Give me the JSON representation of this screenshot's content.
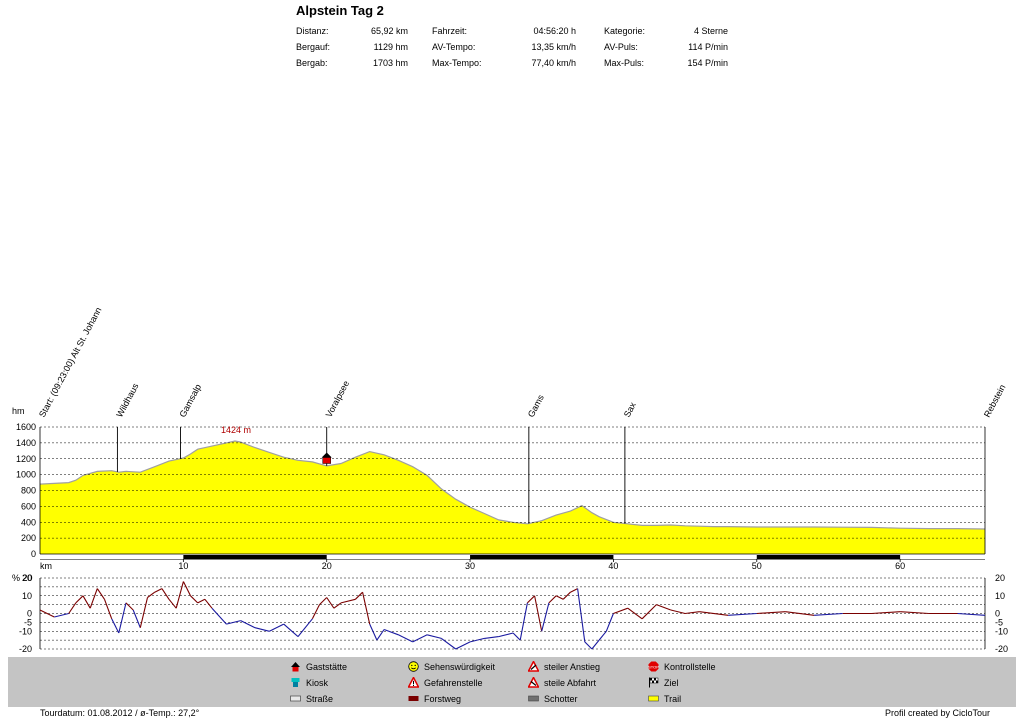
{
  "title": "Alpstein Tag 2",
  "stats": [
    [
      {
        "label": "Distanz:",
        "value": "65,92 km"
      },
      {
        "label": "Fahrzeit:",
        "value": "04:56:20 h"
      },
      {
        "label": "Kategorie:",
        "value": "4 Sterne"
      }
    ],
    [
      {
        "label": "Bergauf:",
        "value": "1129 hm"
      },
      {
        "label": "AV-Tempo:",
        "value": "13,35 km/h"
      },
      {
        "label": "AV-Puls:",
        "value": "114 P/min"
      }
    ],
    [
      {
        "label": "Bergab:",
        "value": "1703 hm"
      },
      {
        "label": "Max-Tempo:",
        "value": "77,40 km/h"
      },
      {
        "label": "Max-Puls:",
        "value": "154 P/min"
      }
    ]
  ],
  "colors": {
    "profile_fill": "#ffff00",
    "profile_line": "#a0a0a0",
    "grade_pos": "#7a0000",
    "grade_neg": "#1a1aa0",
    "km_band": "#000000",
    "legend_bg": "#c4c4c4"
  },
  "chart_data": [
    {
      "type": "area",
      "ylabel": "hm",
      "xlabel": "km",
      "xlim": [
        0,
        65.92
      ],
      "ylim": [
        0,
        1600
      ],
      "yticks": [
        0,
        200,
        400,
        600,
        800,
        1000,
        1200,
        1400,
        1600
      ],
      "xticks": [
        10,
        20,
        30,
        40,
        50,
        60
      ],
      "grid": true,
      "max_label": "1424 m",
      "max_point": {
        "x": 13.6,
        "y": 1424
      },
      "x": [
        0,
        1,
        2,
        2.5,
        3,
        4,
        5,
        5.5,
        6,
        7,
        8,
        9,
        10,
        10.5,
        11,
        12,
        13,
        13.6,
        14,
        15,
        16,
        17,
        18,
        19,
        20,
        21,
        22,
        23,
        24,
        25,
        26,
        27,
        28,
        29,
        30,
        31,
        32,
        33,
        34,
        35,
        36,
        37,
        37.8,
        38.5,
        39,
        40,
        41,
        42,
        43,
        44,
        45,
        46,
        47,
        48,
        50,
        52,
        54,
        56,
        58,
        60,
        62,
        64,
        65.92
      ],
      "y": [
        880,
        890,
        900,
        930,
        990,
        1040,
        1050,
        1030,
        1040,
        1030,
        1100,
        1170,
        1210,
        1260,
        1320,
        1360,
        1400,
        1424,
        1410,
        1340,
        1280,
        1220,
        1180,
        1160,
        1110,
        1140,
        1220,
        1290,
        1250,
        1180,
        1100,
        990,
        820,
        690,
        590,
        510,
        430,
        400,
        380,
        420,
        490,
        540,
        610,
        520,
        470,
        400,
        380,
        360,
        360,
        365,
        355,
        350,
        345,
        345,
        340,
        340,
        340,
        338,
        335,
        325,
        320,
        320,
        315
      ],
      "annotations": [
        {
          "x": 0,
          "label": "Start: (09:23:00) Alt St. Johann"
        },
        {
          "x": 5.4,
          "label": "Wildhaus"
        },
        {
          "x": 9.8,
          "label": "Gamsalp"
        },
        {
          "x": 20,
          "label": "Voralpsee"
        },
        {
          "x": 34.1,
          "label": "Gams"
        },
        {
          "x": 40.8,
          "label": "Sax"
        },
        {
          "x": 65.92,
          "label": "Rebstein"
        }
      ],
      "km_band": [
        [
          10,
          20
        ],
        [
          30,
          40
        ],
        [
          50,
          60
        ]
      ]
    },
    {
      "type": "line",
      "ylabel": "% 20",
      "xlim": [
        0,
        65.92
      ],
      "ylim": [
        -20,
        20
      ],
      "yticks": [
        -20,
        -15,
        -10,
        -5,
        0,
        5,
        10,
        15,
        20
      ],
      "yticklabels_left": [
        "-20",
        "-10",
        "-5",
        "0",
        "10",
        "20"
      ],
      "yticklabels_right": [
        "-20",
        "-10",
        "-5",
        "0",
        "10",
        "20"
      ],
      "x": [
        0,
        1,
        2,
        2.5,
        3,
        3.5,
        4,
        4.5,
        5,
        5.5,
        6,
        6.5,
        7,
        7.5,
        8,
        8.5,
        9,
        9.5,
        10,
        10.5,
        11,
        11.5,
        12,
        13,
        14,
        15,
        16,
        17,
        18,
        19,
        19.5,
        20,
        20.5,
        21,
        22,
        22.5,
        23,
        23.5,
        24,
        25,
        26,
        27,
        28,
        29,
        30,
        31,
        32,
        33,
        33.5,
        34,
        34.5,
        35,
        35.5,
        36,
        36.5,
        37,
        37.5,
        38,
        38.5,
        39,
        39.5,
        40,
        41,
        42,
        43,
        44,
        45,
        46,
        48,
        50,
        52,
        54,
        56,
        58,
        60,
        62,
        64,
        65.92
      ],
      "y": [
        2,
        -2,
        0,
        6,
        10,
        3,
        14,
        8,
        -3,
        -11,
        6,
        2,
        -8,
        9,
        12,
        14,
        8,
        3,
        18,
        10,
        6,
        8,
        3,
        -6,
        -4,
        -8,
        -10,
        -6,
        -13,
        -3,
        5,
        9,
        3,
        6,
        8,
        12,
        -6,
        -15,
        -9,
        -12,
        -16,
        -12,
        -14,
        -20,
        -16,
        -14,
        -13,
        -11,
        -15,
        6,
        10,
        -10,
        6,
        10,
        8,
        12,
        14,
        -16,
        -20,
        -15,
        -10,
        0,
        3,
        -3,
        5,
        2,
        0,
        1,
        -1,
        0,
        1,
        -1,
        0,
        0,
        1,
        0,
        0,
        -1
      ]
    }
  ],
  "legend": [
    {
      "icon": "house-icon",
      "label": "Gaststätte"
    },
    {
      "icon": "smiley-icon",
      "label": "Sehenswürdigkeit"
    },
    {
      "icon": "steep-up-icon",
      "label": "steiler Anstieg"
    },
    {
      "icon": "stop-icon",
      "label": "Kontrollstelle"
    },
    {
      "icon": "kiosk-icon",
      "label": "Kiosk"
    },
    {
      "icon": "warning-icon",
      "label": "Gefahrenstelle"
    },
    {
      "icon": "steep-down-icon",
      "label": "steile Abfahrt"
    },
    {
      "icon": "flag-icon",
      "label": "Ziel"
    },
    {
      "icon": "road-icon",
      "label": "Straße"
    },
    {
      "icon": "forest-road-icon",
      "label": "Forstweg"
    },
    {
      "icon": "gravel-icon",
      "label": "Schotter"
    },
    {
      "icon": "trail-icon",
      "label": "Trail"
    }
  ],
  "footer": {
    "left": "Tourdatum: 01.08.2012  /  ø-Temp.: 27,2°",
    "right": "Profil created by CicloTour"
  }
}
